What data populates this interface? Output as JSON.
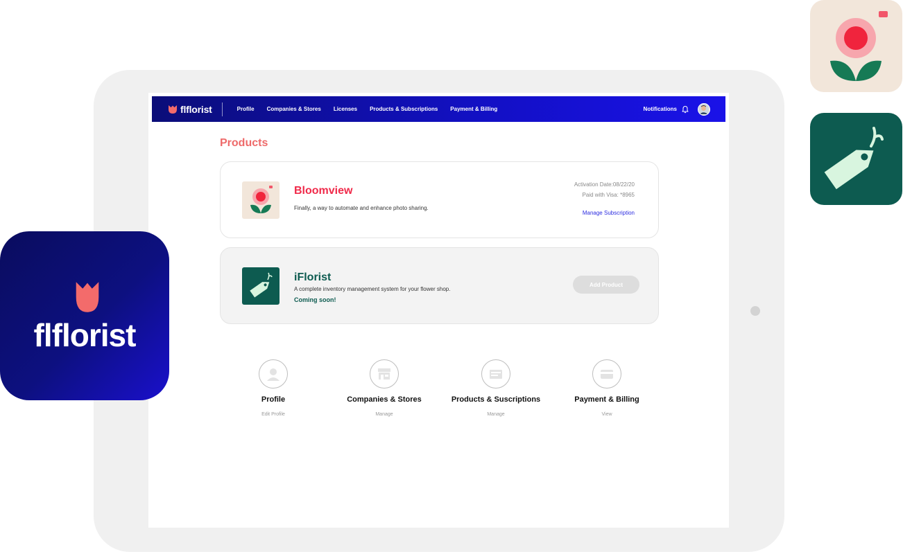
{
  "nav": {
    "brand": "flflorist",
    "links": [
      "Profile",
      "Companies & Stores",
      "Licenses",
      "Products & Subscriptions",
      "Payment & Billing"
    ],
    "notifications_label": "Notifications"
  },
  "page": {
    "title": "Products"
  },
  "products": [
    {
      "name": "Bloomview",
      "description": "Finally, a way to automate and enhance photo sharing.",
      "activation": "Activation Date:08/22/20",
      "payment": "Paid with Visa: *8965",
      "action": "Manage Subscription"
    },
    {
      "name": "iFlorist",
      "description": "A complete inventory management system for your flower shop.",
      "status": "Coming soon!",
      "action": "Add Product"
    }
  ],
  "shortcuts": [
    {
      "title": "Profile",
      "sub": "Edit Profile",
      "icon": "user-icon"
    },
    {
      "title": "Companies & Stores",
      "sub": "Manage",
      "icon": "store-icon"
    },
    {
      "title": "Products & Suscriptions",
      "sub": "Manage",
      "icon": "product-icon"
    },
    {
      "title": "Payment & Billing",
      "sub": "View",
      "icon": "credit-card-icon"
    }
  ],
  "showcase": {
    "logo_text": "flflorist"
  },
  "colors": {
    "nav_start": "#0b0d78",
    "nav_end": "#1a12e8",
    "accent_coral": "#ee6a6a",
    "bloom_red": "#f02a4a",
    "iflorist_green": "#0d5b50",
    "link_blue": "#2b2be0"
  }
}
